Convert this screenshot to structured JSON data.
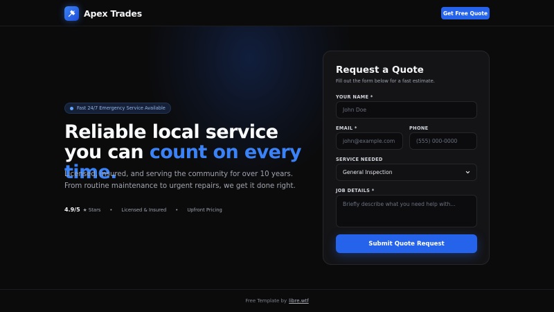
{
  "nav": {
    "brand_name": "Apex Trades",
    "logo_icon": "hammer-wrench-icon",
    "cta_label": "Get Free Quote"
  },
  "hero": {
    "badge_text": "Fast 24/7 Emergency Service Available",
    "title_plain": "Reliable local service you can ",
    "title_accent": "count on every time.",
    "subtitle_line1": "Licensed, insured, and serving the community for over 10 years.",
    "subtitle_line2": "From routine maintenance to urgent repairs, we get it done right.",
    "rating": "4.9/5",
    "rating_suffix": "★ Stars",
    "separator": "•",
    "stat_2": "Licensed & Insured",
    "stat_3": "Upfront Pricing"
  },
  "form": {
    "title": "Request a Quote",
    "subtitle": "Fill out the form below for a fast estimate.",
    "name_label": "YOUR NAME *",
    "name_placeholder": "John Doe",
    "email_label": "EMAIL *",
    "email_placeholder": "john@example.com",
    "phone_label": "PHONE",
    "phone_placeholder": "(555) 000-0000",
    "service_label": "SERVICE NEEDED",
    "service_selected": "General Inspection",
    "details_label": "JOB DETAILS *",
    "details_placeholder": "Briefly describe what you need help with...",
    "submit_label": "Submit Quote Request"
  },
  "footer": {
    "text": "Free Template by",
    "link": "libre.wtf"
  },
  "colors": {
    "accent": "#2563eb",
    "accent_text": "#3b82f6",
    "background": "#0b0b0c",
    "card": "#141416"
  }
}
